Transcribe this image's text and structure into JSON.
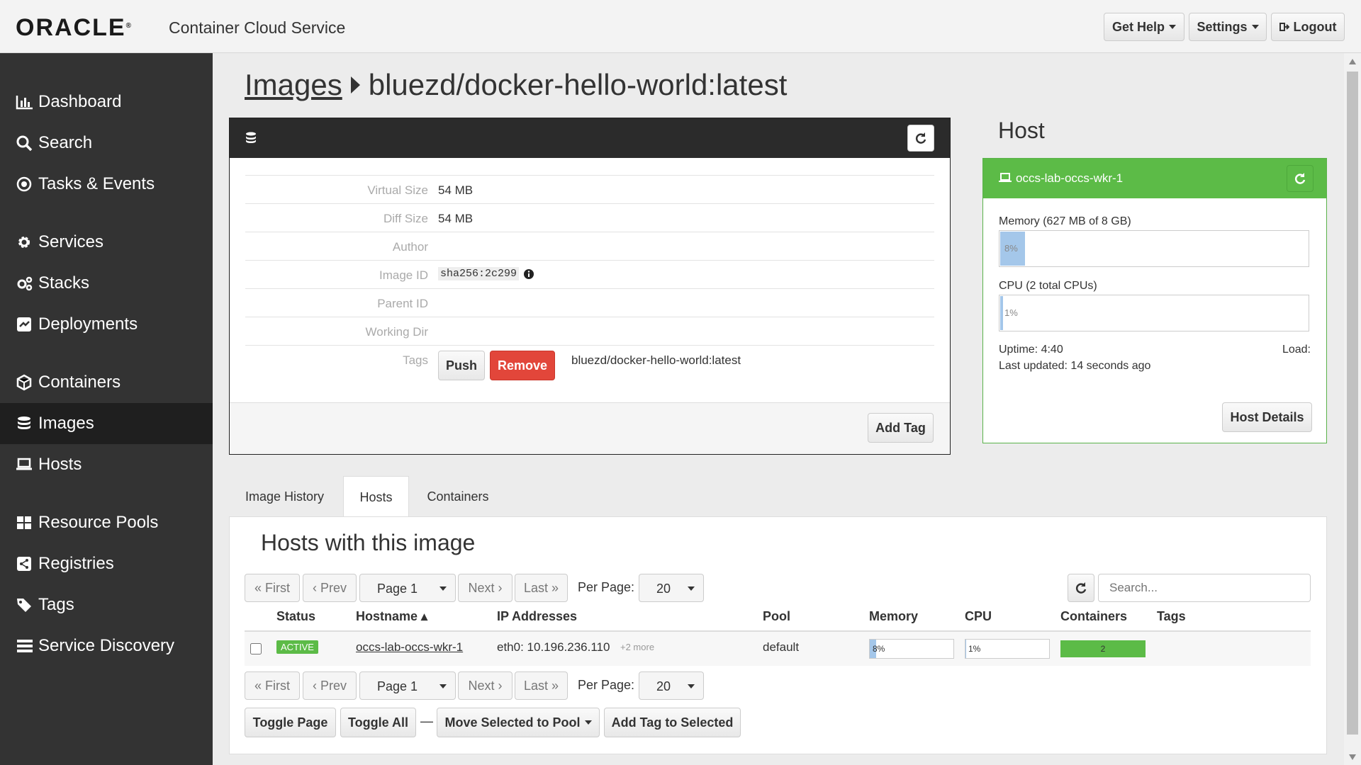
{
  "header": {
    "logo": "ORACLE",
    "product": "Container Cloud Service",
    "get_help": "Get Help",
    "settings": "Settings",
    "logout": "Logout"
  },
  "sidebar": {
    "items": [
      {
        "label": "Dashboard",
        "icon": "bar-chart-icon"
      },
      {
        "label": "Search",
        "icon": "search-icon"
      },
      {
        "label": "Tasks & Events",
        "icon": "target-icon"
      },
      {
        "label": "Services",
        "icon": "gear-icon"
      },
      {
        "label": "Stacks",
        "icon": "gears-icon"
      },
      {
        "label": "Deployments",
        "icon": "deploy-icon"
      },
      {
        "label": "Containers",
        "icon": "cube-icon"
      },
      {
        "label": "Images",
        "icon": "database-icon",
        "active": true
      },
      {
        "label": "Hosts",
        "icon": "laptop-icon"
      },
      {
        "label": "Resource Pools",
        "icon": "grid-icon"
      },
      {
        "label": "Registries",
        "icon": "share-icon"
      },
      {
        "label": "Tags",
        "icon": "tag-icon"
      },
      {
        "label": "Service Discovery",
        "icon": "list-icon"
      }
    ]
  },
  "breadcrumb": {
    "parent": "Images",
    "current": "bluezd/docker-hello-world:latest"
  },
  "image": {
    "rows": [
      {
        "key": "Virtual Size",
        "value": "54 MB"
      },
      {
        "key": "Diff Size",
        "value": "54 MB"
      },
      {
        "key": "Author",
        "value": ""
      },
      {
        "key": "Image ID",
        "value": "sha256:2c299"
      },
      {
        "key": "Parent ID",
        "value": ""
      },
      {
        "key": "Working Dir",
        "value": ""
      }
    ],
    "tags_label": "Tags",
    "push": "Push",
    "remove": "Remove",
    "tag_value": "bluezd/docker-hello-world:latest",
    "add_tag": "Add Tag"
  },
  "host": {
    "title": "Host",
    "name": "occs-lab-occs-wkr-1",
    "memory_label": "Memory (627 MB of 8 GB)",
    "memory_pct": "8%",
    "memory_fraction": 0.08,
    "cpu_label": "CPU (2 total CPUs)",
    "cpu_pct": "1%",
    "cpu_fraction": 0.01,
    "uptime": "Uptime: 4:40",
    "load": "Load:",
    "last_updated": "Last updated: 14 seconds ago",
    "details_button": "Host Details"
  },
  "tabs": [
    "Image History",
    "Hosts",
    "Containers"
  ],
  "hosts_table": {
    "title": "Hosts with this image",
    "pager": {
      "first": "« First",
      "prev": "‹ Prev",
      "page": "Page 1",
      "next": "Next ›",
      "last": "Last »",
      "per_page_label": "Per Page:",
      "per_page": "20"
    },
    "search_placeholder": "Search...",
    "columns": [
      "Status",
      "Hostname ▴",
      "IP Addresses",
      "Pool",
      "Memory",
      "CPU",
      "Containers",
      "Tags"
    ],
    "rows": [
      {
        "status": "ACTIVE",
        "hostname": "occs-lab-occs-wkr-1",
        "ip": "eth0: 10.196.236.110",
        "ip_more": "+2 more",
        "pool": "default",
        "memory": "8%",
        "cpu": "1%",
        "containers": "2",
        "tags": ""
      }
    ],
    "toggle_page": "Toggle Page",
    "toggle_all": "Toggle All",
    "dash": "—",
    "move_to_pool": "Move Selected to Pool",
    "add_tag_selected": "Add Tag to Selected"
  }
}
